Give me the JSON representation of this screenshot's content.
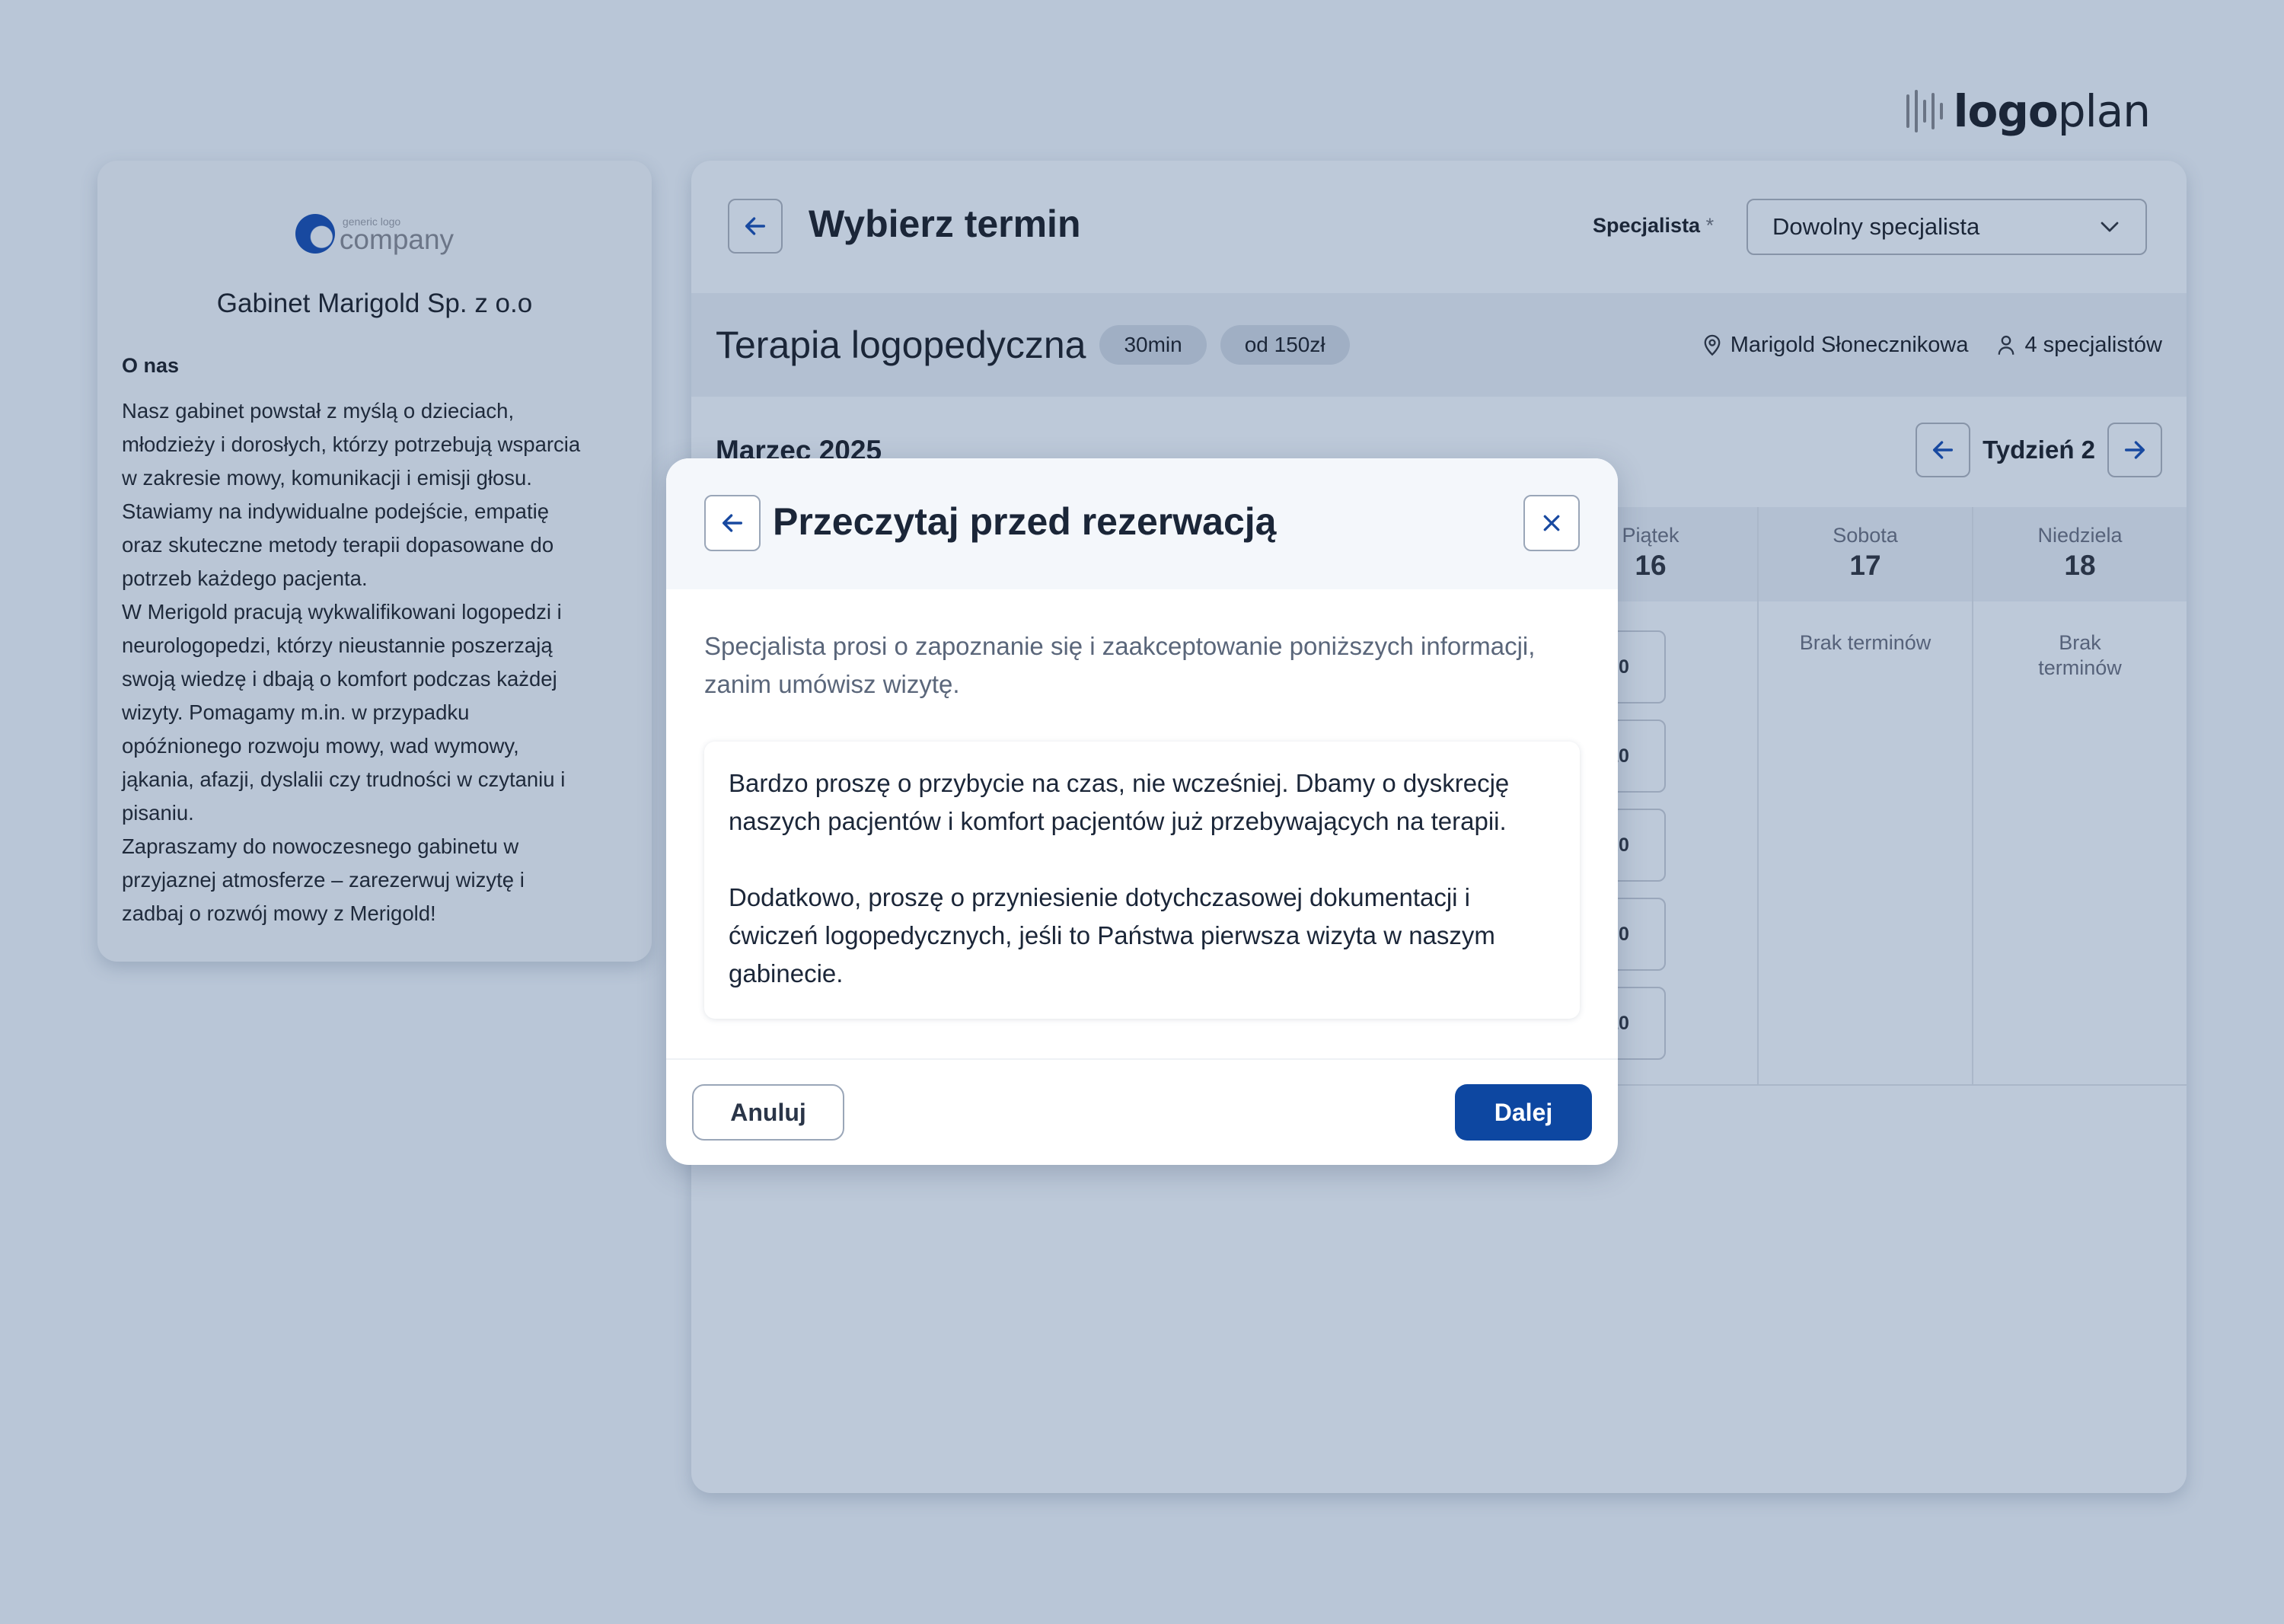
{
  "brand": {
    "logo_bold": "logo",
    "logo_light": "plan",
    "accent": "#0d47a1"
  },
  "clinic": {
    "logo_small": "generic logo",
    "logo_big": "company",
    "name": "Gabinet Marigold Sp. z o.o",
    "about_heading": "O nas",
    "about_text": "Nasz gabinet powstał z myślą o dzieciach,\nmłodzieży i dorosłych, którzy potrzebują wsparcia\nw zakresie mowy, komunikacji i emisji głosu.\nStawiamy na indywidualne podejście, empatię\noraz skuteczne metody terapii dopasowane do\npotrzeb każdego pacjenta.\nW Merigold pracują wykwalifikowani logopedzi i\nneurologopedzi, którzy nieustannie poszerzają\nswoją wiedzę i dbają o komfort podczas każdej\nwizyty. Pomagamy m.in. w przypadku\nopóźnionego rozwoju mowy, wad wymowy,\njąkania, afazji, dyslalii czy trudności w czytaniu i\npisaniu.\nZapraszamy do nowoczesnego gabinetu w\nprzyjaznej atmosferze – zarezerwuj wizytę i\nzadbaj o rozwój mowy z Merigold!"
  },
  "header": {
    "title": "Wybierz termin",
    "specialist_label": "Specjalista",
    "required_mark": "*",
    "specialist_value": "Dowolny specjalista"
  },
  "service": {
    "name": "Terapia logopedyczna",
    "duration": "30min",
    "price": "od 150zł",
    "location": "Marigold Słonecznikowa",
    "specialists": "4 specjalistów"
  },
  "calendar": {
    "month": "Marzec 2025",
    "week": "Tydzień 2",
    "days": [
      {
        "name": "Piątek",
        "num": "16",
        "slots": [
          "08:00",
          "09:10",
          "10:20",
          "14:00",
          "15:10"
        ],
        "none": ""
      },
      {
        "name": "Sobota",
        "num": "17",
        "slots": [],
        "none": "Brak terminów"
      },
      {
        "name": "Niedziela",
        "num": "18",
        "slots": [],
        "none": "Brak terminów"
      }
    ]
  },
  "modal": {
    "title": "Przeczytaj przed rezerwacją",
    "intro": "Specjalista prosi o zapoznanie się i zaakceptowanie poniższych informacji, zanim umówisz wizytę.",
    "note_1": "Bardzo proszę o przybycie na czas, nie wcześniej. Dbamy o dyskrecję naszych pacjentów i komfort pacjentów już przebywających na terapii.",
    "note_2": "Dodatkowo, proszę o przyniesienie dotychczasowej dokumentacji i ćwiczeń logopedycznych, jeśli to Państwa pierwsza wizyta w naszym gabinecie.",
    "cancel_label": "Anuluj",
    "next_label": "Dalej"
  }
}
